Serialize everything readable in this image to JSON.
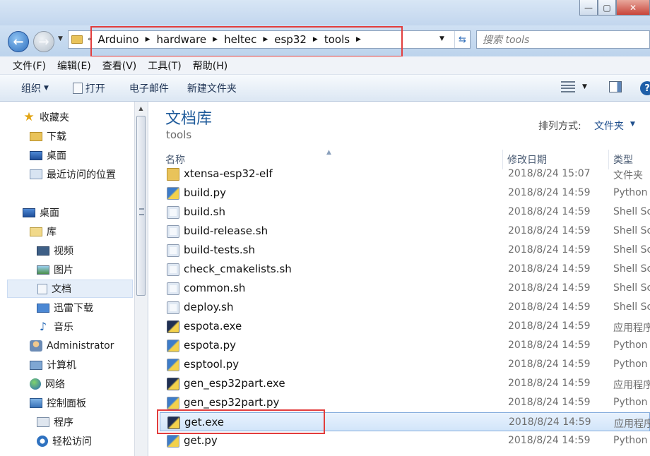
{
  "window": {
    "minimize_glyph": "—",
    "maximize_glyph": "▢",
    "close_glyph": "✕"
  },
  "address": {
    "overflow": "«",
    "crumbs": [
      "Arduino",
      "hardware",
      "heltec",
      "esp32",
      "tools"
    ],
    "search_placeholder": "搜索 tools"
  },
  "menu": [
    "文件(F)",
    "编辑(E)",
    "查看(V)",
    "工具(T)",
    "帮助(H)"
  ],
  "toolbar": {
    "organize": "组织",
    "open": "打开",
    "email": "电子邮件",
    "new_folder": "新建文件夹",
    "help": "?"
  },
  "nav": {
    "favorites": "收藏夹",
    "downloads": "下载",
    "desktop_fav": "桌面",
    "recent": "最近访问的位置",
    "desktop": "桌面",
    "libraries": "库",
    "videos": "视频",
    "pictures": "图片",
    "documents": "文档",
    "xunlei": "迅雷下载",
    "music": "音乐",
    "user": "Administrator",
    "computer": "计算机",
    "network": "网络",
    "control_panel": "控制面板",
    "programs": "程序",
    "ease_access": "轻松访问"
  },
  "content": {
    "library_title": "文档库",
    "library_subtitle": "tools",
    "arrange_label": "排列方式:",
    "arrange_value": "文件夹"
  },
  "columns": {
    "name": "名称",
    "date": "修改日期",
    "type": "类型"
  },
  "files": [
    {
      "name": "xtensa-esp32-elf",
      "date": "2018/8/24 15:07",
      "type": "文件夹",
      "icon": "folder-icon"
    },
    {
      "name": "build.py",
      "date": "2018/8/24 14:59",
      "type": "Python",
      "icon": "python-file-icon"
    },
    {
      "name": "build.sh",
      "date": "2018/8/24 14:59",
      "type": "Shell Sc",
      "icon": "script-file-icon"
    },
    {
      "name": "build-release.sh",
      "date": "2018/8/24 14:59",
      "type": "Shell Sc",
      "icon": "script-file-icon"
    },
    {
      "name": "build-tests.sh",
      "date": "2018/8/24 14:59",
      "type": "Shell Sc",
      "icon": "script-file-icon"
    },
    {
      "name": "check_cmakelists.sh",
      "date": "2018/8/24 14:59",
      "type": "Shell Sc",
      "icon": "script-file-icon"
    },
    {
      "name": "common.sh",
      "date": "2018/8/24 14:59",
      "type": "Shell Sc",
      "icon": "script-file-icon"
    },
    {
      "name": "deploy.sh",
      "date": "2018/8/24 14:59",
      "type": "Shell Sc",
      "icon": "script-file-icon"
    },
    {
      "name": "espota.exe",
      "date": "2018/8/24 14:59",
      "type": "应用程序",
      "icon": "exe-file-icon"
    },
    {
      "name": "espota.py",
      "date": "2018/8/24 14:59",
      "type": "Python",
      "icon": "python-file-icon"
    },
    {
      "name": "esptool.py",
      "date": "2018/8/24 14:59",
      "type": "Python",
      "icon": "python-file-icon"
    },
    {
      "name": "gen_esp32part.exe",
      "date": "2018/8/24 14:59",
      "type": "应用程序",
      "icon": "exe-file-icon"
    },
    {
      "name": "gen_esp32part.py",
      "date": "2018/8/24 14:59",
      "type": "Python",
      "icon": "python-file-icon"
    },
    {
      "name": "get.exe",
      "date": "2018/8/24 14:59",
      "type": "应用程序",
      "icon": "exe-file-icon"
    },
    {
      "name": "get.py",
      "date": "2018/8/24 14:59",
      "type": "Python",
      "icon": "python-file-icon"
    }
  ],
  "colors": {
    "highlight_box": "#e23d3d",
    "library_title": "#1e5a9a",
    "selection": "#d2e5fa"
  }
}
